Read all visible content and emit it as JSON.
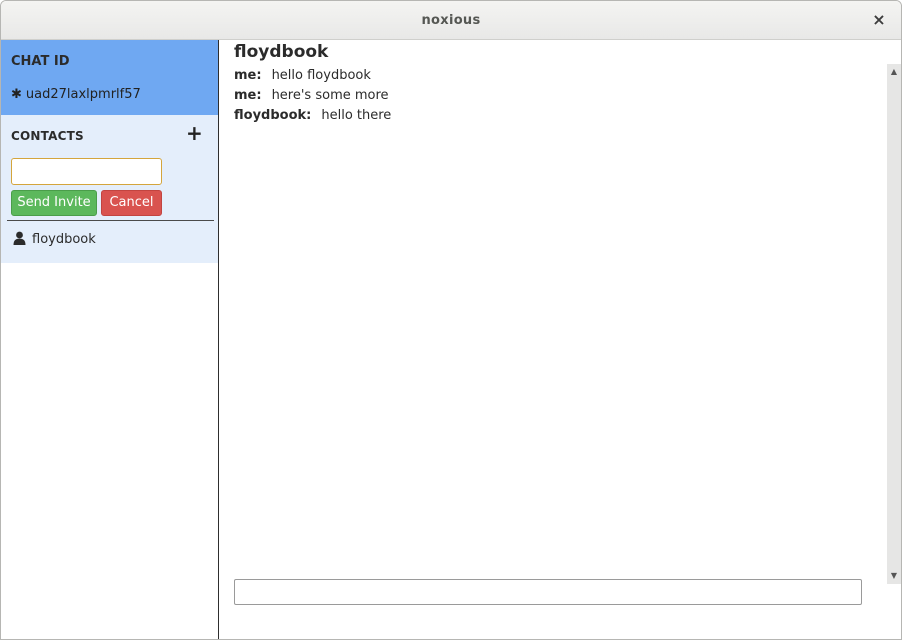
{
  "window": {
    "title": "noxious",
    "close_glyph": "×"
  },
  "sidebar": {
    "chat_id": {
      "heading": "CHAT ID",
      "icon": "asterisk-icon",
      "value": "uad27laxlpmrlf57"
    },
    "contacts": {
      "heading": "CONTACTS",
      "add_icon": "plus-icon",
      "invite_input": {
        "value": "",
        "placeholder": ""
      },
      "send_invite_label": "Send Invite",
      "cancel_label": "Cancel",
      "items": [
        {
          "name": "floydbook",
          "icon": "person-icon"
        }
      ]
    }
  },
  "chat": {
    "contact_name": "floydbook",
    "messages": [
      {
        "sender": "me:",
        "text": "hello floydbook"
      },
      {
        "sender": "me:",
        "text": "here's some more"
      },
      {
        "sender": "floydbook:",
        "text": "hello there"
      }
    ],
    "compose": {
      "value": ""
    }
  },
  "colors": {
    "chat_id_bg": "#6fa8f2",
    "contacts_bg": "#e4eefb",
    "send_button": "#5cb85c",
    "cancel_button": "#d9534f",
    "input_focus_border": "#d4a53c"
  }
}
